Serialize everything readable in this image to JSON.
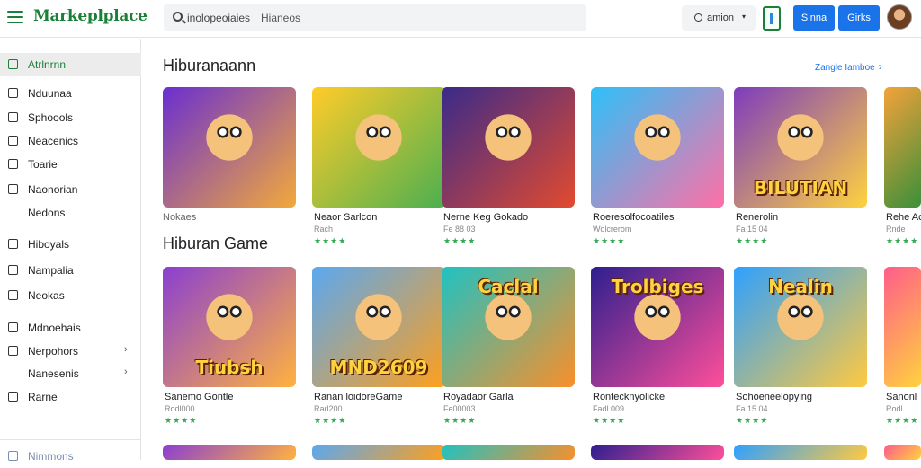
{
  "app": {
    "logo": "Markeplplace"
  },
  "search": {
    "query": "inolopeoiaies",
    "secondary": "Hianeos"
  },
  "topbar": {
    "dropdown_label": "amion",
    "btn1": "Sinna",
    "btn2": "Girks"
  },
  "sidebar": {
    "items": [
      {
        "label": "Atrlnrnn",
        "active": true
      },
      {
        "label": "Nduunaa"
      },
      {
        "label": "Sphoools"
      },
      {
        "label": "Neacenics"
      },
      {
        "label": "Toarie"
      },
      {
        "label": "Naonorian"
      },
      {
        "label": "Nedons"
      },
      {
        "label": "Hiboyals"
      },
      {
        "label": "Nampalia"
      },
      {
        "label": "Neokas"
      },
      {
        "label": "Mdnoehais"
      },
      {
        "label": "Nerpohors"
      },
      {
        "label": "Nanesenis"
      },
      {
        "label": "Rarne"
      },
      {
        "label": "Nimmons"
      }
    ]
  },
  "sections": [
    {
      "title": "Hiburanaann",
      "links": "Zangle   Iamboe",
      "caption": "Nokaes",
      "cards": [
        {
          "name": "",
          "sub": "",
          "stars": "",
          "art": "",
          "colors": [
            "#6a2fd1",
            "#f2a93b"
          ]
        },
        {
          "name": "Neaor Sarlcon",
          "sub": "Rach",
          "stars": "★★★★",
          "art": "",
          "colors": [
            "#ffcc29",
            "#4caf50"
          ]
        },
        {
          "name": "Nerne Keg Gokado",
          "sub": "Fe 88 03",
          "stars": "★★★★",
          "art": "",
          "colors": [
            "#3a2a8a",
            "#e24a2f"
          ]
        },
        {
          "name": "Roeresolfocoatiles",
          "sub": "Wolcrerom",
          "stars": "★★★★",
          "art": "",
          "colors": [
            "#2ec0f9",
            "#ff70a6"
          ]
        },
        {
          "name": "Renerolin",
          "sub": "Fa 15 04",
          "stars": "★★★★",
          "art": "BILUTIAN",
          "colors": [
            "#7d3cbd",
            "#ffd23f"
          ]
        },
        {
          "name": "Rehe Ac",
          "sub": "Rnde",
          "stars": "★★★★",
          "art": "",
          "colors": [
            "#f4a23a",
            "#3a8f3a"
          ]
        }
      ]
    },
    {
      "title": "Hiburan Game",
      "cards": [
        {
          "name": "Sanemo Gontle",
          "sub": "Rodl000",
          "stars": "★★★★",
          "art": "Tiubsh",
          "colors": [
            "#8a3fd1",
            "#ffb23f"
          ]
        },
        {
          "name": "Ranan loidoreGame",
          "sub": "Rarl200",
          "stars": "★★★★",
          "art": "MND2609",
          "colors": [
            "#5aa8f0",
            "#ff9f1c"
          ]
        },
        {
          "name": "Royadaor Garla",
          "sub": "Fe00003",
          "stars": "★★★★",
          "art": "Caclal",
          "colors": [
            "#1fc2c2",
            "#f98f2b"
          ]
        },
        {
          "name": "Rontecknyolicke",
          "sub": "Fadl 009",
          "stars": "★★★★",
          "art": "Trolbiges",
          "colors": [
            "#2d1f8f",
            "#ff4f9a"
          ]
        },
        {
          "name": "Sohoeneelopying",
          "sub": "Fa 15 04",
          "stars": "★★★★",
          "art": "Nealin",
          "colors": [
            "#2ea0ff",
            "#ffc940"
          ]
        },
        {
          "name": "Sanonl",
          "sub": "Rodl",
          "stars": "★★★★",
          "art": "",
          "colors": [
            "#ff5c8a",
            "#ffd23f"
          ]
        }
      ]
    }
  ]
}
